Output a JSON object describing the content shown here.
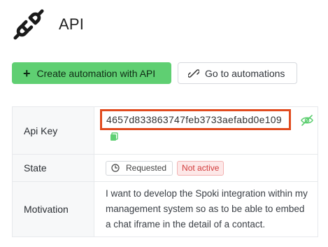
{
  "page": {
    "title": "API",
    "icon": "plug-icon"
  },
  "actions": {
    "create_label": "Create automation with API",
    "goto_label": "Go to automations"
  },
  "details": {
    "api_key_label": "Api Key",
    "api_key_value": "4657d833863747feb3733aefabd0e109",
    "state_label": "State",
    "state_requested": "Requested",
    "state_status": "Not active",
    "motivation_label": "Motivation",
    "motivation_text": "I want to develop the Spoki integration within my management system so as to be able to embed a chat iframe in the detail of a contact."
  },
  "colors": {
    "primary": "#5fcf72",
    "highlight_border": "#e14b1f",
    "inactive_text": "#d23b3b",
    "eye_icon": "#5fcf72"
  }
}
